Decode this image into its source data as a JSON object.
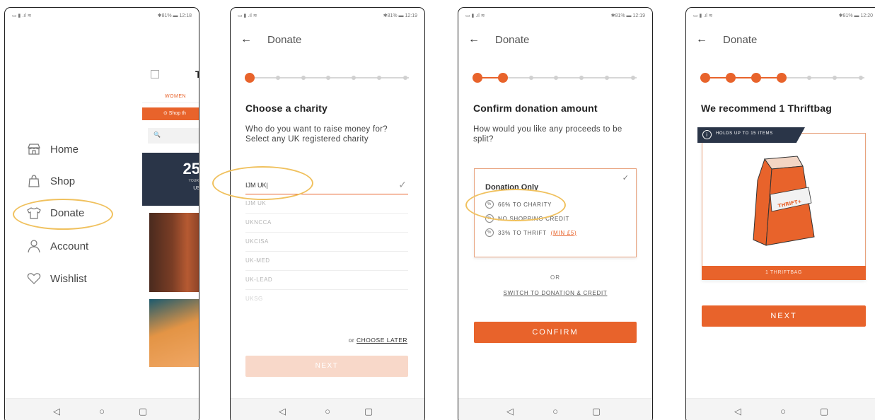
{
  "status": [
    {
      "left": "▭ ▮ .ıl ≋",
      "right": "✱81% ▬ 12:18"
    },
    {
      "left": "▭ ▮ .ıl ≋",
      "right": "✱81% ▬ 12:19"
    },
    {
      "left": "▭ ▮ .ıl ≋",
      "right": "✱81% ▬ 12:19"
    },
    {
      "left": "▭ ▮ .ıl ≋",
      "right": "✱81% ▬ 12:20"
    }
  ],
  "nav": {
    "back": "◁",
    "home": "○",
    "recent": "▢"
  },
  "screen1": {
    "menu": [
      {
        "label": "Home",
        "icon": "store-icon"
      },
      {
        "label": "Shop",
        "icon": "shopping-bag-icon"
      },
      {
        "label": "Donate",
        "icon": "tshirt-icon"
      },
      {
        "label": "Account",
        "icon": "user-icon"
      },
      {
        "label": "Wishlist",
        "icon": "heart-icon"
      }
    ],
    "background": {
      "logo": "T",
      "tab": "WOMEN",
      "strip": "⊙ Shop th",
      "search": "🔍",
      "banner_big": "25",
      "banner_small": "YOUR",
      "banner_us": "US"
    }
  },
  "screen2": {
    "title": "Donate",
    "heading": "Choose a charity",
    "sub": "Who do you want to raise money for? Select any UK registered charity",
    "input_value": "IJM UK|",
    "suggestions": [
      "IJM UK",
      "UKNCCA",
      "UKCISA",
      "UK-MED",
      "UK-LEAD",
      "UKSG"
    ],
    "or_text": "or",
    "choose_later": "CHOOSE LATER",
    "next": "NEXT"
  },
  "screen3": {
    "title": "Donate",
    "heading": "Confirm donation amount",
    "sub": "How would you like any proceeds to be split?",
    "option_title": "Donation Only",
    "lines": [
      {
        "text": "66% TO CHARITY",
        "icon": "%"
      },
      {
        "text": "NO SHOPPING CREDIT",
        "icon": "%"
      },
      {
        "text": "33% TO THRIFT",
        "icon": "%",
        "extra": "(MIN £5)"
      }
    ],
    "or": "OR",
    "switch": "SWITCH TO DONATION & CREDIT",
    "confirm": "CONFIRM"
  },
  "screen4": {
    "title": "Donate",
    "heading": "We recommend 1 Thriftbag",
    "banner": "HOLDS UP TO 15 ITEMS",
    "bag_brand": "THRIFT+",
    "footer": "1 THRIFTBAG",
    "next": "NEXT"
  },
  "colors": {
    "accent": "#e8632b",
    "highlight": "#f0c15e",
    "dark": "#2a3548"
  }
}
